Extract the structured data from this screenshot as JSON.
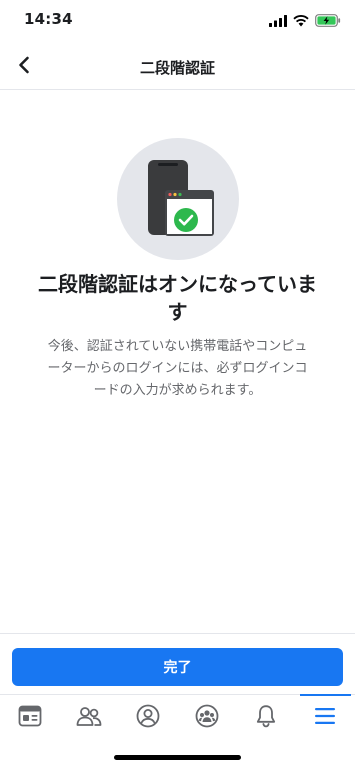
{
  "status_bar": {
    "time": "14:34",
    "icons": [
      "cellular-signal-icon",
      "wifi-icon",
      "battery-charging-icon"
    ]
  },
  "header": {
    "title": "二段階認証",
    "back_icon": "chevron-left-icon"
  },
  "hero": {
    "icons": [
      "smartphone-icon",
      "browser-window-icon",
      "check-circle-icon"
    ]
  },
  "content": {
    "headline_line1": "二段階認証はオンになっていま",
    "headline_line2": "す",
    "description_line1": "今後、認証されていない携帯電話やコンピュ",
    "description_line2": "ーターからのログインには、必ずログインコ",
    "description_line3": "ードの入力が求められます。"
  },
  "actions": {
    "done_label": "完了"
  },
  "tab_bar": {
    "tabs": [
      {
        "icon": "news-feed-icon",
        "active": false
      },
      {
        "icon": "friends-icon",
        "active": false
      },
      {
        "icon": "profile-icon",
        "active": false
      },
      {
        "icon": "groups-icon",
        "active": false
      },
      {
        "icon": "notifications-bell-icon",
        "active": false
      },
      {
        "icon": "menu-icon",
        "active": true
      }
    ]
  },
  "colors": {
    "accent": "#1877f2",
    "success": "#2db84d",
    "icon": "#65676b"
  }
}
